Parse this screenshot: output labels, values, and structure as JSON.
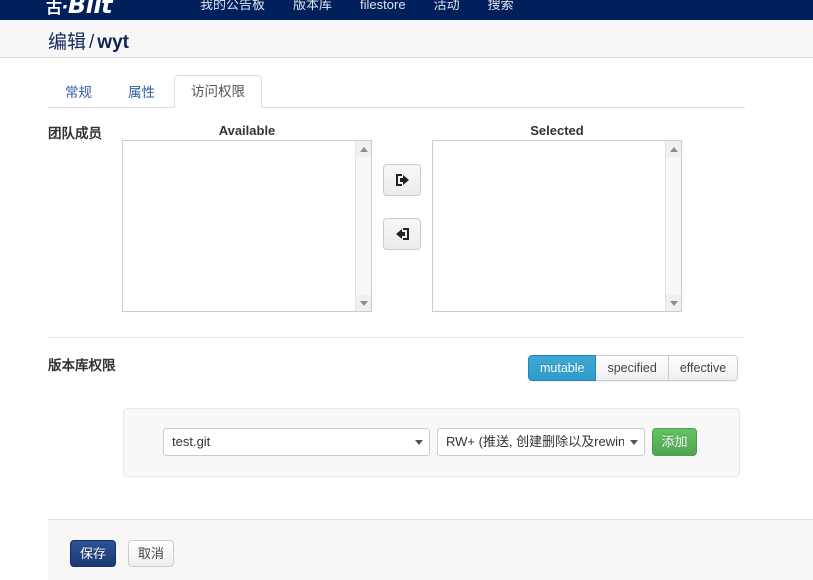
{
  "navbar": {
    "brand_cjk": "古",
    "brand_sep": "·",
    "brand_name": "Biit",
    "background_color": "#00205b",
    "items": [
      {
        "label": "我的公告板",
        "name": "nav-item-dashboard"
      },
      {
        "label": "版本库",
        "name": "nav-item-repositories"
      },
      {
        "label": "filestore",
        "name": "nav-item-filestore"
      },
      {
        "label": "活动",
        "name": "nav-item-activity"
      },
      {
        "label": "搜索",
        "name": "nav-item-search"
      }
    ]
  },
  "breadcrumb": {
    "action": "编辑",
    "separator": "/",
    "repository": "wyt"
  },
  "tabs": [
    {
      "label": "常规",
      "name": "tab-general",
      "active": false
    },
    {
      "label": "属性",
      "name": "tab-properties",
      "active": false
    },
    {
      "label": "访问权限",
      "name": "tab-access-permissions",
      "active": true
    }
  ],
  "team_members": {
    "label": "团队成员",
    "available_title": "Available",
    "selected_title": "Selected",
    "available_items": [],
    "selected_items": [],
    "transfer_right_icon": "arrow-right-into-box-icon",
    "transfer_left_icon": "arrow-left-into-box-icon"
  },
  "repository_permissions": {
    "label": "版本库权限",
    "view_modes": [
      {
        "label": "mutable",
        "active": true
      },
      {
        "label": "specified",
        "active": false
      },
      {
        "label": "effective",
        "active": false
      }
    ],
    "active_color": "#3fa9d4",
    "repo_select": {
      "value": "test.git",
      "options": [
        "test.git"
      ]
    },
    "permission_select": {
      "value": "RW+ (推送, 创建删除以及rewin",
      "options": [
        "RW+ (推送, 创建删除以及rewin"
      ]
    },
    "add_button": "添加",
    "add_button_color": "#51a351"
  },
  "footer": {
    "save_label": "保存",
    "cancel_label": "取消",
    "save_color": "#1b3a73"
  }
}
